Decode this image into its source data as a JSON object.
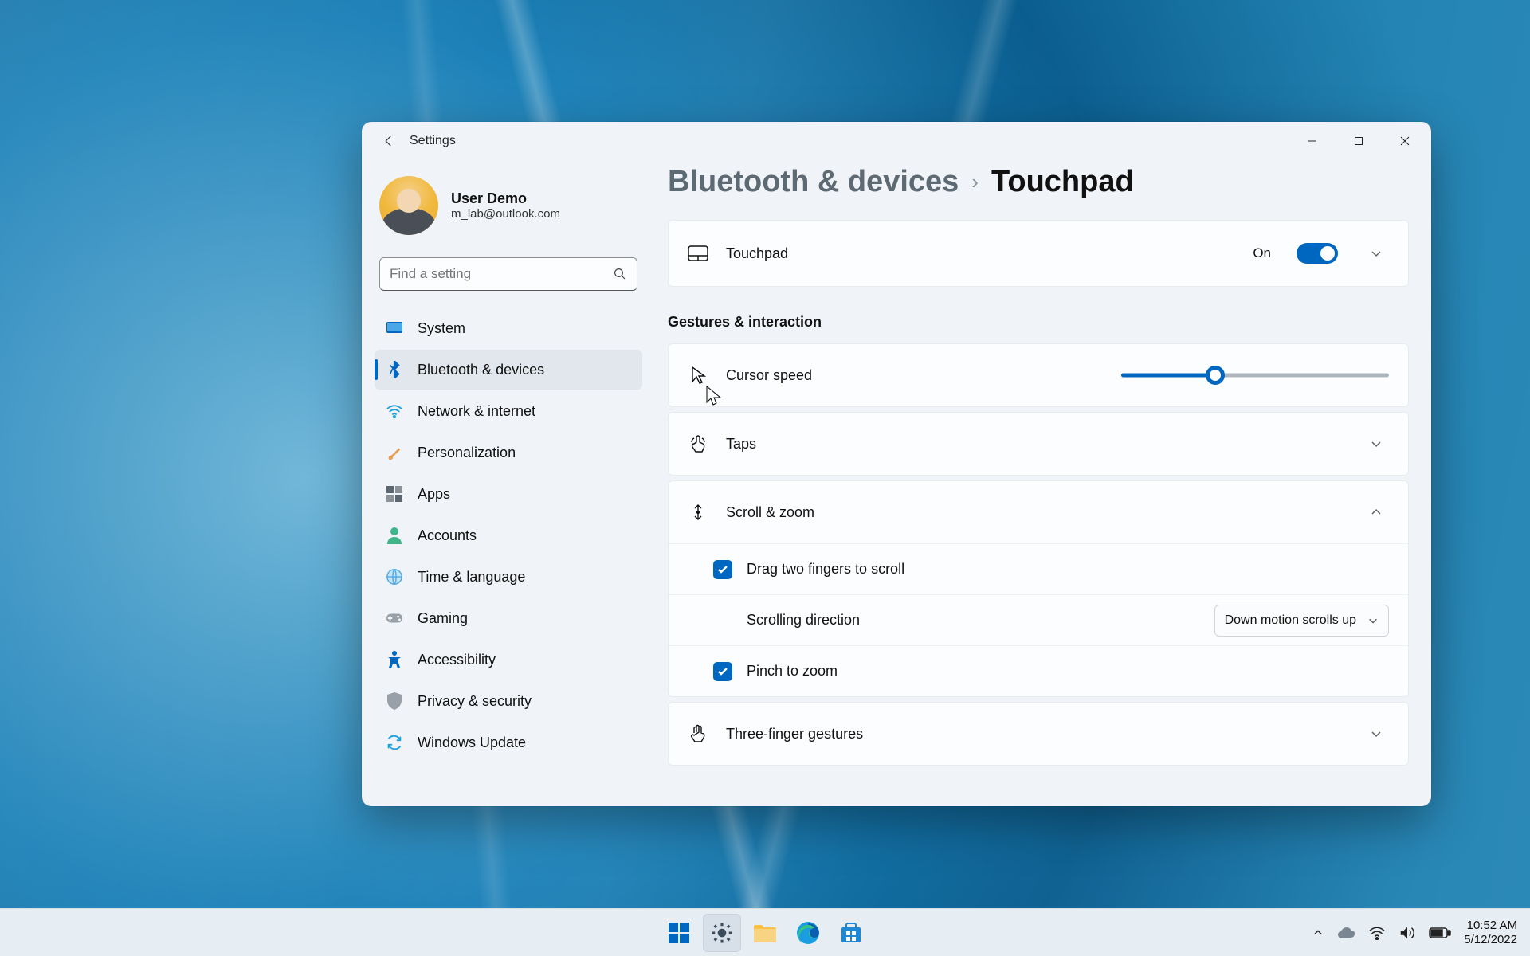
{
  "app_title": "Settings",
  "profile": {
    "name": "User Demo",
    "email": "m_lab@outlook.com"
  },
  "search_placeholder": "Find a setting",
  "sidebar": {
    "items": [
      {
        "label": "System"
      },
      {
        "label": "Bluetooth & devices"
      },
      {
        "label": "Network & internet"
      },
      {
        "label": "Personalization"
      },
      {
        "label": "Apps"
      },
      {
        "label": "Accounts"
      },
      {
        "label": "Time & language"
      },
      {
        "label": "Gaming"
      },
      {
        "label": "Accessibility"
      },
      {
        "label": "Privacy & security"
      },
      {
        "label": "Windows Update"
      }
    ]
  },
  "breadcrumb": {
    "parent": "Bluetooth & devices",
    "current": "Touchpad"
  },
  "touchpad": {
    "label": "Touchpad",
    "state": "On"
  },
  "gestures_heading": "Gestures & interaction",
  "cursor_speed": {
    "label": "Cursor speed"
  },
  "taps": {
    "label": "Taps"
  },
  "scroll_zoom": {
    "label": "Scroll & zoom",
    "drag_label": "Drag two fingers to scroll",
    "direction_label": "Scrolling direction",
    "direction_value": "Down motion scrolls up",
    "pinch_label": "Pinch to zoom"
  },
  "three_finger": {
    "label": "Three-finger gestures"
  },
  "taskbar": {
    "time": "10:52 AM",
    "date": "5/12/2022"
  }
}
